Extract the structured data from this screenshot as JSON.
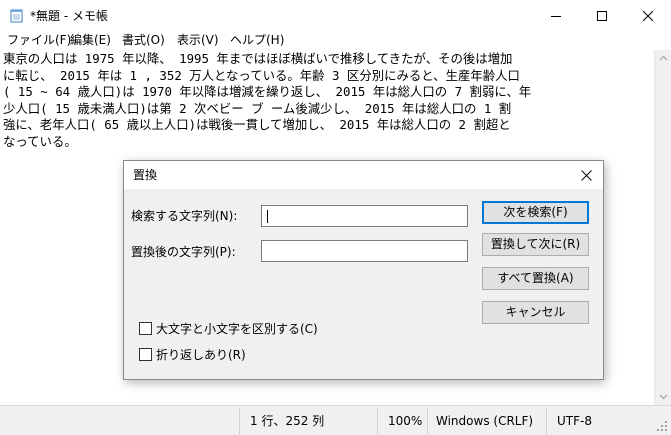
{
  "window": {
    "title": "*無題 - メモ帳"
  },
  "menu": {
    "items": [
      {
        "label": "ファイル(F)"
      },
      {
        "label": "編集(E)"
      },
      {
        "label": "書式(O)"
      },
      {
        "label": "表示(V)"
      },
      {
        "label": "ヘルプ(H)"
      }
    ]
  },
  "editor": {
    "lines": [
      "東京の人口は 1975 年以降、 1995 年まではほぼ横ばいで推移してきたが、その後は増加",
      "に転じ、 2015 年は 1 , 352 万人となっている。年齢 3 区分別にみると、生産年齢人口",
      "( 15 ~ 64 歳人口)は 1970 年以降は増減を繰り返し、 2015 年は総人口の 7 割弱に、年",
      "少人口( 15 歳未満人口)は第 2 次ベビー ブ ーム後減少し、 2015 年は総人口の 1 割",
      "強に、老年人口( 65 歳以上人口)は戦後一貫して増加し、 2015 年は総人口の 2 割超と",
      "なっている。"
    ]
  },
  "status": {
    "position": "1 行、252 列",
    "zoom": "100%",
    "line_ending": "Windows (CRLF)",
    "encoding": "UTF-8"
  },
  "dialog": {
    "title": "置換",
    "find_label": "検索する文字列(N):",
    "find_value": "",
    "replace_label": "置換後の文字列(P):",
    "replace_value": "",
    "find_next_button": "次を検索(F)",
    "replace_button": "置換して次に(R)",
    "replace_all_button": "すべて置換(A)",
    "cancel_button": "キャンセル",
    "match_case_label": "大文字と小文字を区別する(C)",
    "match_case_checked": false,
    "wrap_around_label": "折り返しあり(R)",
    "wrap_around_checked": false
  },
  "colors": {
    "accent": "#0078d7"
  }
}
